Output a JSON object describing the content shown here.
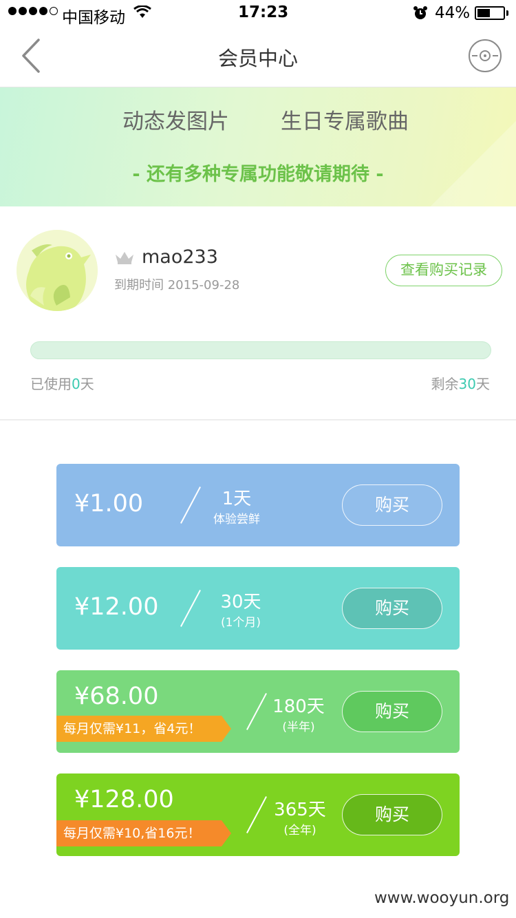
{
  "status_bar": {
    "carrier": "中国移动",
    "time": "17:23",
    "battery": "44%"
  },
  "nav": {
    "title": "会员中心"
  },
  "banner": {
    "feature_1": "动态发图片",
    "feature_2": "生日专属歌曲",
    "tagline": "- 还有多种专属功能敬请期待 -"
  },
  "profile": {
    "username": "mao233",
    "expiry_label": "到期时间",
    "expiry_date": "2015-09-28",
    "history_button": "查看购买记录"
  },
  "usage": {
    "used_prefix": "已使用",
    "used_days": "0",
    "used_suffix": "天",
    "remain_prefix": "剩余",
    "remain_days": "30",
    "remain_suffix": "天",
    "progress_fraction": 0.0
  },
  "plans": [
    {
      "price": "¥1.00",
      "duration": "1天",
      "subtitle": "体验尝鲜",
      "buy": "购买",
      "color": "#8dbbea"
    },
    {
      "price": "¥12.00",
      "duration": "30天",
      "subtitle": "(1个月)",
      "buy": "购买",
      "color": "#6edad0"
    },
    {
      "price": "¥68.00",
      "duration": "180天",
      "subtitle": "(半年)",
      "buy": "购买",
      "promo": "每月仅需¥11，省4元！",
      "color": "#7ad97d"
    },
    {
      "price": "¥128.00",
      "duration": "365天",
      "subtitle": "(全年)",
      "buy": "购买",
      "promo": "每月仅需¥10,省16元！",
      "color": "#7ed321"
    }
  ],
  "colors": {
    "accent_green": "#6cc24a",
    "highlight_teal": "#3ccab0",
    "ribbon_orange_1": "#f5a623",
    "ribbon_orange_2": "#f58a2a"
  },
  "icons": {
    "back": "chevron-left-icon",
    "disc": "disc-icon",
    "crown": "crown-icon",
    "wifi": "wifi-icon",
    "alarm": "alarm-icon",
    "battery": "battery-icon"
  },
  "watermark": "www.wooyun.org"
}
